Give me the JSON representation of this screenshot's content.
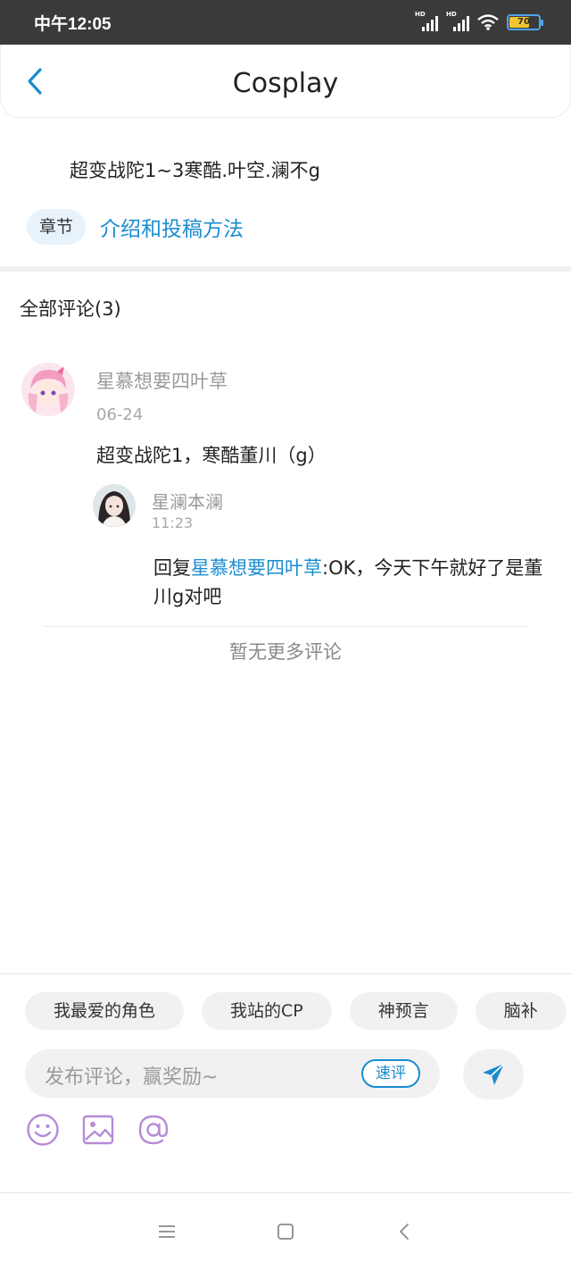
{
  "status": {
    "time": "中午12:05",
    "hd1": "HD",
    "hd2": "HD",
    "battery": "70"
  },
  "header": {
    "title": "Cosplay"
  },
  "post": {
    "title": "超变战陀1~3寒酷.叶空.澜不g",
    "chapter_tag": "章节",
    "chapter_link": "介绍和投稿方法"
  },
  "comments": {
    "header": "全部评论(3)",
    "items": [
      {
        "author": "星慕想要四叶草",
        "date": "06-24",
        "text": "超变战陀1，寒酷董川（g）",
        "reply": {
          "author": "星澜本澜",
          "time": "11:23",
          "prefix": "回复",
          "mention": "星慕想要四叶草",
          "text": ":OK，今天下午就好了是董川g对吧"
        }
      }
    ],
    "no_more": "暂无更多评论"
  },
  "compose": {
    "chips": [
      "我最爱的角色",
      "我站的CP",
      "神预言",
      "脑补"
    ],
    "placeholder": "发布评论，赢奖励~",
    "quick_comment": "速评",
    "icons": [
      "smile-icon",
      "image-icon",
      "at-icon"
    ]
  },
  "colors": {
    "accent": "#1a8cd0",
    "purple": "#b58bd9"
  }
}
